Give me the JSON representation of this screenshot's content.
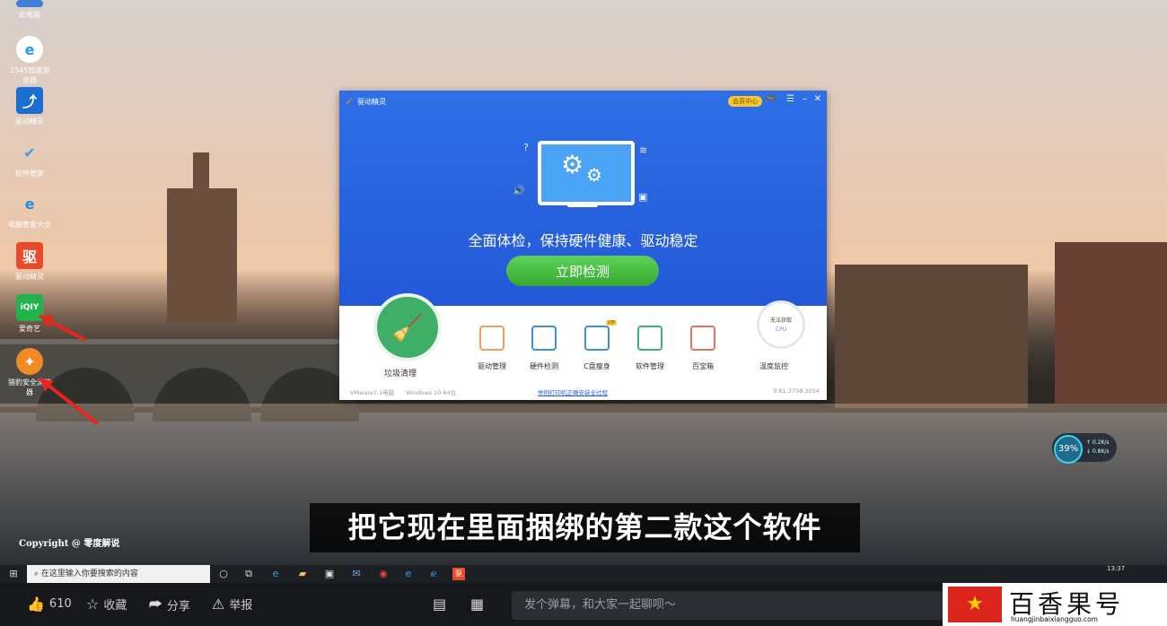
{
  "desktop_icons": [
    {
      "label": "此电脑",
      "glyph": "",
      "color": "#3f7fd8"
    },
    {
      "label": "2345加速浏览器",
      "glyph": "e",
      "color": "#2a9ae0"
    },
    {
      "label": "驱动精灵",
      "glyph": "⤴",
      "color": "#1b6fd1"
    },
    {
      "label": "软件管家",
      "glyph": "✔",
      "color": "#3aa0e8"
    },
    {
      "label": "电脑管家大全",
      "glyph": "e",
      "color": "#1f8de0"
    },
    {
      "label": "驱动精灵",
      "glyph": "驱",
      "color": "#e84a2a"
    },
    {
      "label": "爱奇艺",
      "glyph": "iQIY",
      "color": "#23b34b"
    },
    {
      "label": "猎豹安全浏览器",
      "glyph": "✦",
      "color": "#f08a24"
    }
  ],
  "app": {
    "title": "驱动精灵",
    "vip": "会员中心",
    "controls": [
      "🎮",
      "☰",
      "–",
      "✕"
    ],
    "headline": "全面体检，保持硬件健康、驱动稳定",
    "scan_button": "立即检测",
    "clean_label": "垃圾清理",
    "tools": [
      {
        "label": "驱动管理",
        "color": "#f0a060",
        "badge": ""
      },
      {
        "label": "硬件检测",
        "color": "#3e8fe0",
        "badge": ""
      },
      {
        "label": "C盘瘦身",
        "color": "#3e8fe0",
        "badge": "VIP"
      },
      {
        "label": "软件管理",
        "color": "#3fb07a",
        "badge": ""
      },
      {
        "label": "百宝箱",
        "color": "#e87060",
        "badge": ""
      }
    ],
    "cpu_ring_text": "无法获取",
    "cpu_text": "CPU",
    "temp_label": "温度监控",
    "footer_left_1": "VMware7.1电脑",
    "footer_left_2": "Windows 10 64位",
    "footer_link": "举例打印机正确安装全过程",
    "footer_version": "9.61.3708.3054"
  },
  "speed_widget": {
    "percent": "39%",
    "up": "↑ 0.2K/s",
    "down": "↓ 0.8K/s"
  },
  "subtitle": "把它现在里面捆绑的第二款这个软件",
  "copyright": "Copyright @ 零度解说",
  "taskbar": {
    "search_placeholder": "在这里输入你要搜索的内容",
    "clock": "13:37"
  },
  "bottom_bar": {
    "like_count": "610",
    "favorite": "收藏",
    "share": "分享",
    "report": "举报",
    "danmaku_placeholder": "发个弹幕，和大家一起聊呗～"
  },
  "brand": {
    "name": "百香果号",
    "url": "huangjinbaixiangguo.com"
  }
}
